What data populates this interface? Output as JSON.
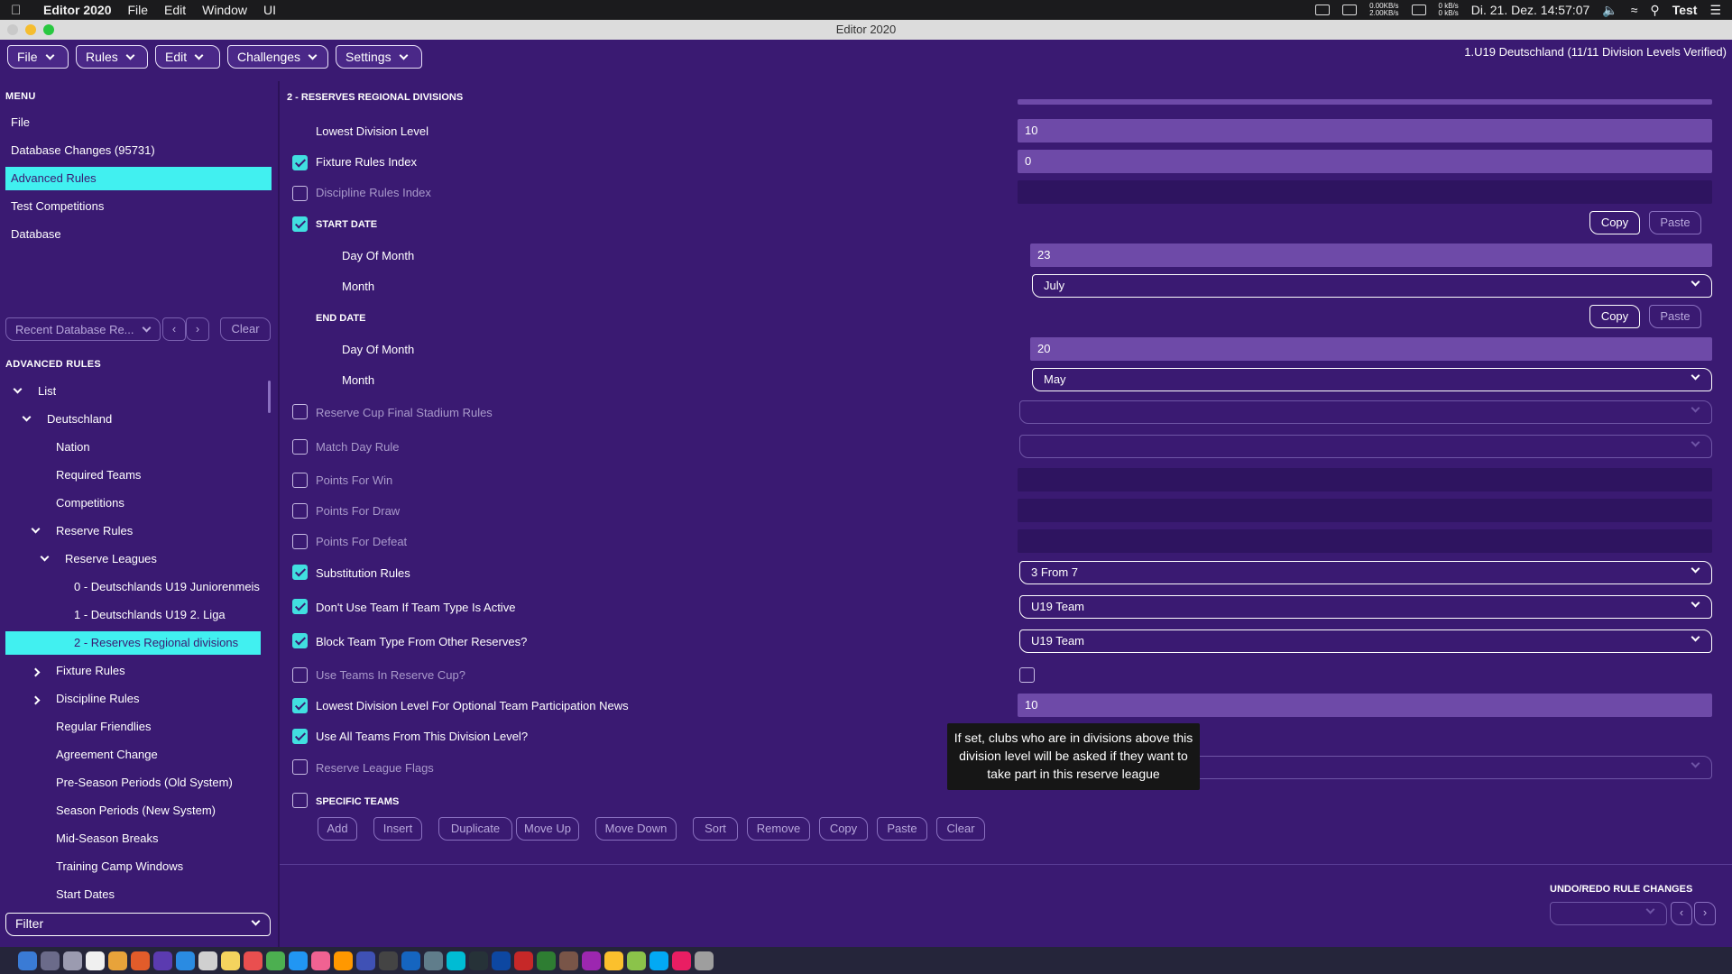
{
  "menubar": {
    "app_name": "Editor 2020",
    "menus": [
      "File",
      "Edit",
      "Window",
      "UI"
    ],
    "net_up": "0.00KB/s",
    "net_down": "2.00KB/s",
    "disk_read": "0 kB/s",
    "disk_write": "0 kB/s",
    "datetime": "Di. 21. Dez. 14:57:07",
    "user": "Test"
  },
  "window": {
    "title": "Editor 2020"
  },
  "toolbar": {
    "file": "File",
    "rules": "Rules",
    "edit": "Edit",
    "challenges": "Challenges",
    "settings": "Settings",
    "status": "1.U19 Deutschland (11/11 Division Levels Verified)"
  },
  "sidebar": {
    "menu_title": "MENU",
    "menu_items": [
      "File",
      "Database Changes (95731)",
      "Advanced Rules",
      "Test Competitions",
      "Database"
    ],
    "recent_label": "Recent Database Re...",
    "nav_prev": "‹",
    "nav_next": "›",
    "clear_label": "Clear",
    "adv_title": "ADVANCED RULES",
    "tree": [
      "List",
      "Deutschland",
      "Nation",
      "Required Teams",
      "Competitions",
      "Reserve Rules",
      "Reserve Leagues",
      "0 - Deutschlands U19 Juniorenmeis",
      "1 - Deutschlands U19 2. Liga",
      "2 - Reserves Regional divisions",
      "Fixture Rules",
      "Discipline Rules",
      "Regular Friendlies",
      "Agreement Change",
      "Pre-Season Periods (Old System)",
      "Season Periods (New System)",
      "Mid-Season Breaks",
      "Training Camp Windows",
      "Start Dates"
    ],
    "filter_label": "Filter"
  },
  "main": {
    "title": "2 - RESERVES REGIONAL DIVISIONS",
    "lowest_division_level": {
      "label": "Lowest Division Level",
      "value": "10"
    },
    "fixture_rules_index": {
      "label": "Fixture Rules Index",
      "value": "0"
    },
    "discipline_rules_index": {
      "label": "Discipline Rules Index"
    },
    "start_date": {
      "label": "START DATE",
      "day_label": "Day Of Month",
      "day": "23",
      "month_label": "Month",
      "month": "July",
      "copy": "Copy",
      "paste": "Paste"
    },
    "end_date": {
      "label": "END DATE",
      "day_label": "Day Of Month",
      "day": "20",
      "month_label": "Month",
      "month": "May",
      "copy": "Copy",
      "paste": "Paste"
    },
    "reserve_cup_final": "Reserve Cup Final Stadium Rules",
    "match_day_rule": "Match Day Rule",
    "points_win": "Points For Win",
    "points_draw": "Points For Draw",
    "points_defeat": "Points For Defeat",
    "substitution": {
      "label": "Substitution Rules",
      "value": "3 From 7"
    },
    "dont_use_team": {
      "label": "Don't Use Team If Team Type Is Active",
      "value": "U19 Team"
    },
    "block_team": {
      "label": "Block Team Type From Other Reserves?",
      "value": "U19 Team"
    },
    "use_teams_reserve_cup": "Use Teams In Reserve Cup?",
    "lowest_optional_news": {
      "label": "Lowest Division Level For Optional Team Participation News",
      "value": "10"
    },
    "use_all_teams": "Use All Teams From This Division Level?",
    "reserve_league_flags": "Reserve League Flags",
    "specific_teams": "SPECIFIC TEAMS",
    "list_buttons": [
      "Add",
      "Insert",
      "Duplicate",
      "Move Up",
      "Move Down",
      "Sort",
      "Remove",
      "Copy",
      "Paste",
      "Clear"
    ],
    "tooltip": "If set, clubs who are in divisions above this division level will be asked if they want to take part in this reserve league",
    "undo_title": "UNDO/REDO RULE CHANGES"
  },
  "colors": {
    "background": "#3a1a72",
    "accent": "#41f0f0",
    "field": "#6e4aa8"
  }
}
